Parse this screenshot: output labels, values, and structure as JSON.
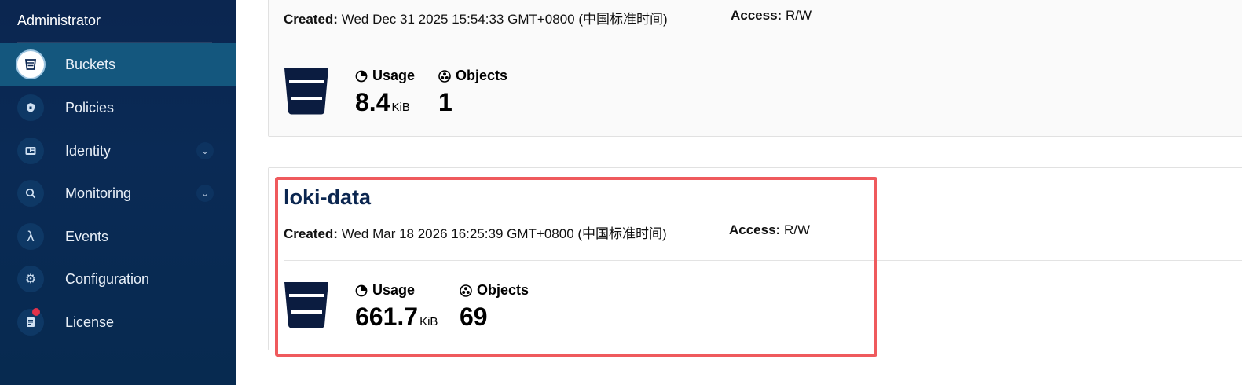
{
  "sidebar": {
    "header": "Administrator",
    "items": [
      {
        "label": "Buckets",
        "icon": "bucket-icon"
      },
      {
        "label": "Policies",
        "icon": "shield-icon"
      },
      {
        "label": "Identity",
        "icon": "id-card-icon"
      },
      {
        "label": "Monitoring",
        "icon": "monitor-search-icon"
      },
      {
        "label": "Events",
        "icon": "lambda-icon"
      },
      {
        "label": "Configuration",
        "icon": "gear-icon"
      },
      {
        "label": "License",
        "icon": "document-icon"
      }
    ]
  },
  "buckets": [
    {
      "name": "",
      "created_label": "Created:",
      "created_value": "Wed Dec 31 2025 15:54:33 GMT+0800 (中国标准时间)",
      "access_label": "Access:",
      "access_value": "R/W",
      "usage_label": "Usage",
      "usage_value": "8.4",
      "usage_unit": "KiB",
      "objects_label": "Objects",
      "objects_value": "1"
    },
    {
      "name": "loki-data",
      "created_label": "Created:",
      "created_value": "Wed Mar 18 2026 16:25:39 GMT+0800 (中国标准时间)",
      "access_label": "Access:",
      "access_value": "R/W",
      "usage_label": "Usage",
      "usage_value": "661.7",
      "usage_unit": "KiB",
      "objects_label": "Objects",
      "objects_value": "69"
    }
  ],
  "colors": {
    "sidebar_bg": "#0b2650",
    "active_item": "#14577e",
    "highlight": "#ef5a5d",
    "title": "#0b2650"
  }
}
